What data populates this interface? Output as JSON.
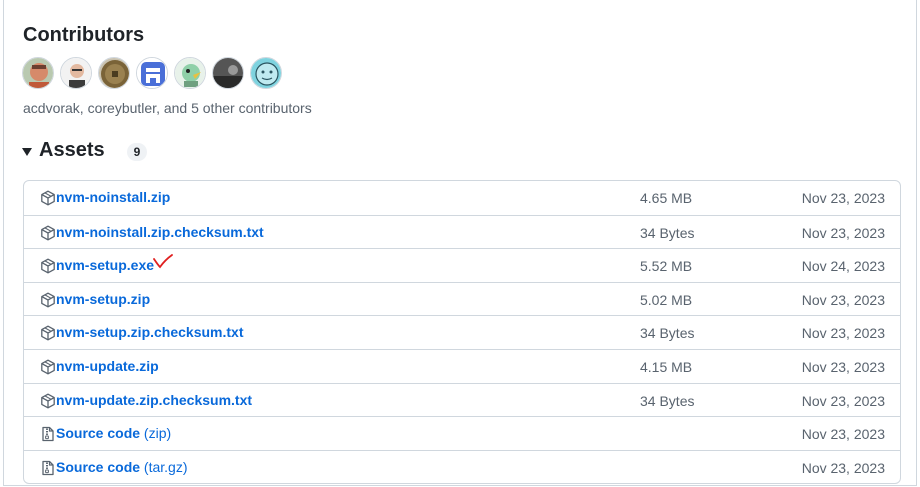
{
  "contributors": {
    "title": "Contributors",
    "summary": "acdvorak, coreybutler, and 5 other contributors",
    "avatars": [
      {
        "icon": "avatar-photo-smiling-man",
        "color": "#c05a3a"
      },
      {
        "icon": "avatar-photo-man-glasses",
        "color": "#e8e8e8"
      },
      {
        "icon": "avatar-coin",
        "color": "#7a6338"
      },
      {
        "icon": "avatar-blue-logo",
        "color": "#4a6fd8"
      },
      {
        "icon": "avatar-cartoon-bird",
        "color": "#8fd0a8"
      },
      {
        "icon": "avatar-dark-photo",
        "color": "#333333"
      },
      {
        "icon": "avatar-cartoon-face",
        "color": "#7fd3df"
      }
    ]
  },
  "assets": {
    "title": "Assets",
    "count": "9",
    "items": [
      {
        "icon": "package-icon",
        "name": "nvm-noinstall.zip",
        "suffix": "",
        "size": "4.65 MB",
        "date": "Nov 23, 2023"
      },
      {
        "icon": "package-icon",
        "name": "nvm-noinstall.zip.checksum.txt",
        "suffix": "",
        "size": "34 Bytes",
        "date": "Nov 23, 2023"
      },
      {
        "icon": "package-icon",
        "name": "nvm-setup.exe",
        "suffix": "",
        "size": "5.52 MB",
        "date": "Nov 24, 2023",
        "annotated": true
      },
      {
        "icon": "package-icon",
        "name": "nvm-setup.zip",
        "suffix": "",
        "size": "5.02 MB",
        "date": "Nov 23, 2023"
      },
      {
        "icon": "package-icon",
        "name": "nvm-setup.zip.checksum.txt",
        "suffix": "",
        "size": "34 Bytes",
        "date": "Nov 23, 2023"
      },
      {
        "icon": "package-icon",
        "name": "nvm-update.zip",
        "suffix": "",
        "size": "4.15 MB",
        "date": "Nov 23, 2023"
      },
      {
        "icon": "package-icon",
        "name": "nvm-update.zip.checksum.txt",
        "suffix": "",
        "size": "34 Bytes",
        "date": "Nov 23, 2023"
      },
      {
        "icon": "file-zip-icon",
        "name": "Source code",
        "suffix": "(zip)",
        "size": "",
        "date": "Nov 23, 2023"
      },
      {
        "icon": "file-zip-icon",
        "name": "Source code",
        "suffix": "(tar.gz)",
        "size": "",
        "date": "Nov 23, 2023"
      }
    ]
  },
  "colors": {
    "link": "#0969da",
    "muted": "#59636e",
    "border": "#d0d7de",
    "annotation": "#e02020"
  }
}
